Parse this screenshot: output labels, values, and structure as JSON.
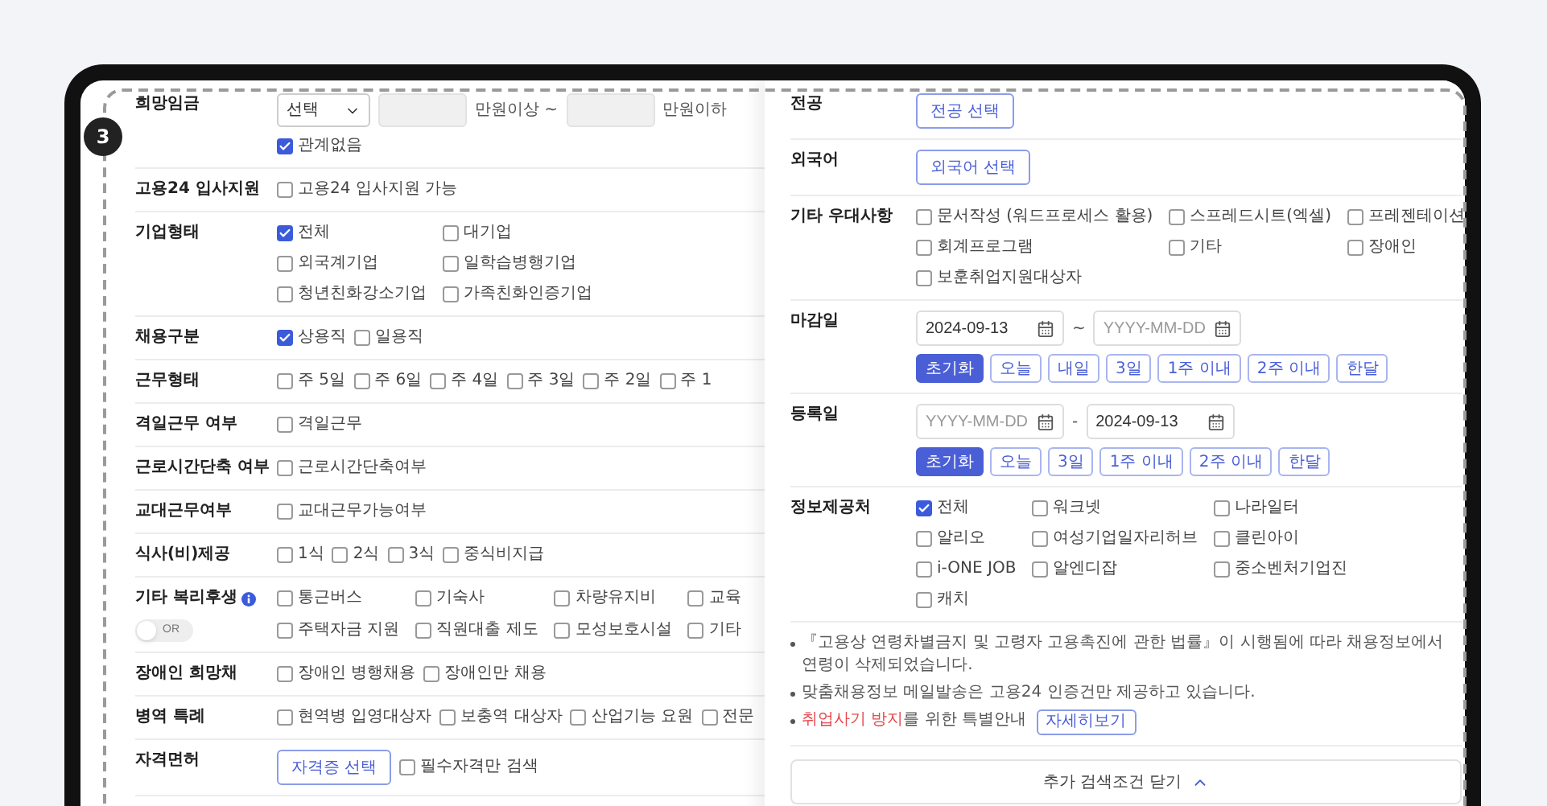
{
  "step_badge": "3",
  "left_form": {
    "rows": [
      {
        "label": "희망임금",
        "kind": "inline",
        "lines": [
          [
            {
              "kind": "select",
              "value": "선택"
            },
            {
              "kind": "input"
            },
            {
              "kind": "text",
              "text": "만원이상 ~"
            },
            {
              "kind": "input"
            },
            {
              "kind": "text",
              "text": "만원이하"
            }
          ],
          [
            {
              "kind": "checkbox",
              "label": "관계없음",
              "checked": true
            }
          ]
        ]
      },
      {
        "label": "고용24 입사지원",
        "kind": "inline",
        "lines": [
          [
            {
              "kind": "checkbox",
              "label": "고용24 입사지원 가능",
              "checked": false
            }
          ]
        ]
      },
      {
        "label": "기업형태",
        "kind": "grid",
        "lines": [
          [
            {
              "kind": "checkbox",
              "label": "전체",
              "checked": true
            },
            {
              "kind": "checkbox",
              "label": "대기업",
              "checked": false
            }
          ],
          [
            {
              "kind": "checkbox",
              "label": "외국계기업",
              "checked": false
            },
            {
              "kind": "checkbox",
              "label": "일학습병행기업",
              "checked": false
            }
          ],
          [
            {
              "kind": "checkbox",
              "label": "청년친화강소기업",
              "checked": false
            },
            {
              "kind": "checkbox",
              "label": "가족친화인증기업",
              "checked": false
            }
          ]
        ]
      },
      {
        "label": "채용구분",
        "kind": "inline",
        "lines": [
          [
            {
              "kind": "checkbox",
              "label": "상용직",
              "checked": true
            },
            {
              "kind": "checkbox",
              "label": "일용직",
              "checked": false
            }
          ]
        ]
      },
      {
        "label": "근무형태",
        "kind": "inline",
        "lines": [
          [
            {
              "kind": "checkbox",
              "label": "주 5일",
              "checked": false
            },
            {
              "kind": "checkbox",
              "label": "주 6일",
              "checked": false
            },
            {
              "kind": "checkbox",
              "label": "주 4일",
              "checked": false
            },
            {
              "kind": "checkbox",
              "label": "주 3일",
              "checked": false
            },
            {
              "kind": "checkbox",
              "label": "주 2일",
              "checked": false
            },
            {
              "kind": "checkbox",
              "label": "주 1",
              "checked": false
            }
          ]
        ]
      },
      {
        "label": "격일근무 여부",
        "kind": "inline",
        "lines": [
          [
            {
              "kind": "checkbox",
              "label": "격일근무",
              "checked": false
            }
          ]
        ]
      },
      {
        "label": "근로시간단축 여부",
        "kind": "inline",
        "lines": [
          [
            {
              "kind": "checkbox",
              "label": "근로시간단축여부",
              "checked": false
            }
          ]
        ]
      },
      {
        "label": "교대근무여부",
        "kind": "inline",
        "lines": [
          [
            {
              "kind": "checkbox",
              "label": "교대근무가능여부",
              "checked": false
            }
          ]
        ]
      },
      {
        "label": "식사(비)제공",
        "kind": "inline",
        "lines": [
          [
            {
              "kind": "checkbox",
              "label": "1식",
              "checked": false
            },
            {
              "kind": "checkbox",
              "label": "2식",
              "checked": false
            },
            {
              "kind": "checkbox",
              "label": "3식",
              "checked": false
            },
            {
              "kind": "checkbox",
              "label": "중식비지급",
              "checked": false
            }
          ]
        ]
      },
      {
        "label": "기타 복리후생",
        "info": true,
        "toggle": {
          "label": "OR",
          "on": false
        },
        "kind": "grid",
        "lines": [
          [
            {
              "kind": "checkbox",
              "label": "통근버스",
              "checked": false
            },
            {
              "kind": "checkbox",
              "label": "기숙사",
              "checked": false
            },
            {
              "kind": "checkbox",
              "label": "차량유지비",
              "checked": false
            },
            {
              "kind": "checkbox",
              "label": "교육",
              "checked": false
            }
          ],
          [
            {
              "kind": "checkbox",
              "label": "주택자금 지원",
              "checked": false
            },
            {
              "kind": "checkbox",
              "label": "직원대출 제도",
              "checked": false
            },
            {
              "kind": "checkbox",
              "label": "모성보호시설",
              "checked": false
            },
            {
              "kind": "checkbox",
              "label": "기타",
              "checked": false
            }
          ]
        ]
      },
      {
        "label": "장애인 희망채",
        "kind": "inline",
        "lines": [
          [
            {
              "kind": "checkbox",
              "label": "장애인 병행채용",
              "checked": false
            },
            {
              "kind": "checkbox",
              "label": "장애인만 채용",
              "checked": false
            }
          ]
        ]
      },
      {
        "label": "병역 특례",
        "kind": "inline",
        "lines": [
          [
            {
              "kind": "checkbox",
              "label": "현역병 입영대상자",
              "checked": false
            },
            {
              "kind": "checkbox",
              "label": "보충역 대상자",
              "checked": false
            },
            {
              "kind": "checkbox",
              "label": "산업기능 요원",
              "checked": false
            },
            {
              "kind": "checkbox",
              "label": "전문",
              "checked": false
            }
          ]
        ]
      },
      {
        "label": "자격면허",
        "kind": "inline",
        "lines": [
          [
            {
              "kind": "button",
              "label": "자격증 선택"
            },
            {
              "kind": "checkbox",
              "label": "필수자격만 검색",
              "checked": false
            }
          ]
        ]
      }
    ]
  },
  "right_form": {
    "rows": [
      {
        "label": "전공",
        "kind": "inline",
        "lines": [
          [
            {
              "kind": "button",
              "label": "전공 선택"
            }
          ]
        ]
      },
      {
        "label": "외국어",
        "kind": "inline",
        "lines": [
          [
            {
              "kind": "button",
              "label": "외국어 선택"
            }
          ]
        ]
      },
      {
        "label": "기타 우대사항",
        "kind": "grid",
        "lines": [
          [
            {
              "kind": "checkbox",
              "label": "문서작성 (워드프로세스 활용)",
              "checked": false
            },
            {
              "kind": "checkbox",
              "label": "스프레드시트(엑셀)",
              "checked": false
            },
            {
              "kind": "checkbox",
              "label": "프레젠테이션",
              "checked": false
            }
          ],
          [
            {
              "kind": "checkbox",
              "label": "회계프로그램",
              "checked": false
            },
            {
              "kind": "checkbox",
              "label": "기타",
              "checked": false
            },
            {
              "kind": "checkbox",
              "label": "장애인",
              "checked": false
            }
          ],
          [
            {
              "kind": "checkbox",
              "label": "보훈취업지원대상자",
              "checked": false
            }
          ]
        ]
      },
      {
        "label": "마감일",
        "kind": "inline",
        "lines": [
          [
            {
              "kind": "date",
              "value": "2024-09-13"
            },
            {
              "kind": "text",
              "text": "~"
            },
            {
              "kind": "date",
              "placeholder": "YYYY-MM-DD"
            }
          ],
          [
            {
              "kind": "preset",
              "label": "초기화",
              "selected": true
            },
            {
              "kind": "preset",
              "label": "오늘",
              "selected": false
            },
            {
              "kind": "preset",
              "label": "내일",
              "selected": false
            },
            {
              "kind": "preset",
              "label": "3일",
              "selected": false
            },
            {
              "kind": "preset",
              "label": "1주 이내",
              "selected": false
            },
            {
              "kind": "preset",
              "label": "2주 이내",
              "selected": false
            },
            {
              "kind": "preset",
              "label": "한달",
              "selected": false
            }
          ]
        ]
      },
      {
        "label": "등록일",
        "kind": "inline",
        "lines": [
          [
            {
              "kind": "date",
              "placeholder": "YYYY-MM-DD"
            },
            {
              "kind": "text",
              "text": "-"
            },
            {
              "kind": "date",
              "value": "2024-09-13"
            }
          ],
          [
            {
              "kind": "preset",
              "label": "초기화",
              "selected": true
            },
            {
              "kind": "preset",
              "label": "오늘",
              "selected": false
            },
            {
              "kind": "preset",
              "label": "3일",
              "selected": false
            },
            {
              "kind": "preset",
              "label": "1주 이내",
              "selected": false
            },
            {
              "kind": "preset",
              "label": "2주 이내",
              "selected": false
            },
            {
              "kind": "preset",
              "label": "한달",
              "selected": false
            }
          ]
        ]
      },
      {
        "label": "정보제공처",
        "kind": "grid",
        "lines": [
          [
            {
              "kind": "checkbox",
              "label": "전체",
              "checked": true
            },
            {
              "kind": "checkbox",
              "label": "워크넷",
              "checked": false
            },
            {
              "kind": "checkbox",
              "label": "나라일터",
              "checked": false
            }
          ],
          [
            {
              "kind": "checkbox",
              "label": "알리오",
              "checked": false
            },
            {
              "kind": "checkbox",
              "label": "여성기업일자리허브",
              "checked": false
            },
            {
              "kind": "checkbox",
              "label": "클린아이",
              "checked": false
            }
          ],
          [
            {
              "kind": "checkbox",
              "label": "i-ONE JOB",
              "checked": false
            },
            {
              "kind": "checkbox",
              "label": "알엔디잡",
              "checked": false
            },
            {
              "kind": "checkbox",
              "label": "중소벤처기업진",
              "checked": false
            }
          ],
          [
            {
              "kind": "checkbox",
              "label": "캐치",
              "checked": false
            }
          ]
        ]
      }
    ],
    "notes": [
      {
        "text": "『고용상 연령차별금지 및 고령자 고용촉진에 관한 법률』이 시행됨에 따라 채용정보에서 연령이 삭제되었습니다."
      },
      {
        "text": "맞춤채용정보 메일발송은 고용24 인증건만 제공하고 있습니다."
      },
      {
        "highlight": "취업사기 방지",
        "text": "를 위한 특별안내",
        "button": "자세히보기"
      }
    ],
    "collapse_button": "추가 검색조건 닫기"
  }
}
